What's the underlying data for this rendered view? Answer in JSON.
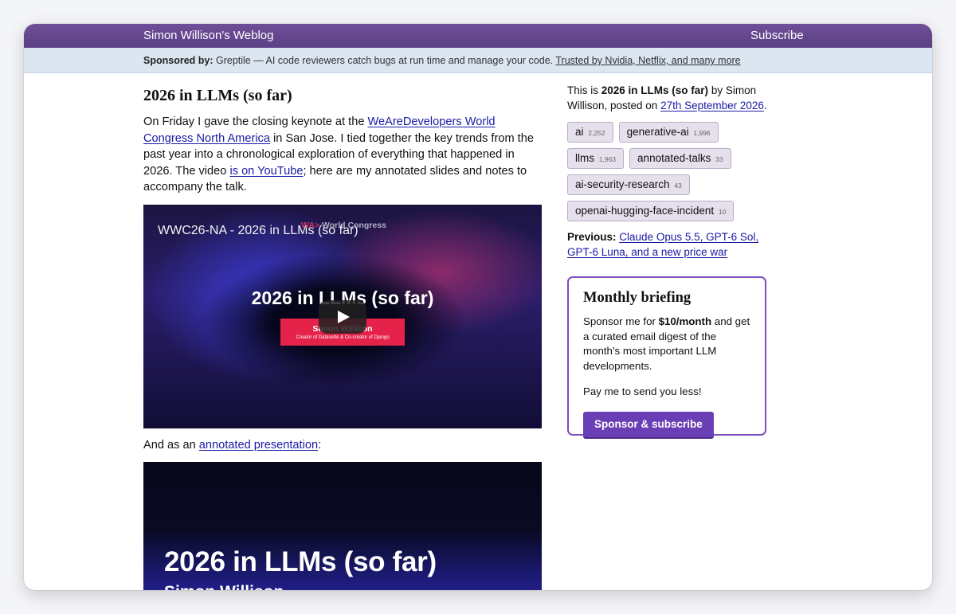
{
  "header": {
    "site_title": "Simon Willison's Weblog",
    "subscribe_label": "Subscribe"
  },
  "sponsor": {
    "label": "Sponsored by:",
    "text": " Greptile — AI code reviewers catch bugs at run time and manage your code. ",
    "link_text": "Trusted by Nvidia, Netflix, and many more"
  },
  "post": {
    "title": "2026 in LLMs (so far)",
    "intro_1": "On Friday I gave the closing keynote at the ",
    "intro_link_1": "WeAreDevelopers World Congress North America",
    "intro_2": " in San Jose. I tied together the key trends from the past year into a chronological exploration of everything that happened in 2026. The video ",
    "intro_link_2": "is on YouTube",
    "intro_3": "; here are my annotated slides and notes to accompany the talk.",
    "video": {
      "title": "WWC26-NA - 2026 in LLMs (so far)",
      "brand_mark": "WA>",
      "brand_text": "World Congress",
      "headline": "2026 in LLMs (so far)",
      "name_card": "Simon Willison",
      "name_sub": "Creator of Datasette & Co-creator of Django"
    },
    "and_as_1": "And as an ",
    "and_as_link": "annotated presentation",
    "and_as_2": ":",
    "presentation": {
      "title": "2026 in LLMs (so far)",
      "author": "Simon Willison"
    }
  },
  "sidebar": {
    "byline_1": "This is ",
    "byline_title": "2026 in LLMs (so far)",
    "byline_2": " by Simon Willison, posted on ",
    "byline_date": "27th September 2026",
    "byline_3": ".",
    "tags": [
      {
        "name": "ai",
        "count": "2,252"
      },
      {
        "name": "generative-ai",
        "count": "1,996"
      },
      {
        "name": "llms",
        "count": "1,963"
      },
      {
        "name": "annotated-talks",
        "count": "33"
      },
      {
        "name": "ai-security-research",
        "count": "43"
      },
      {
        "name": "openai-hugging-face-incident",
        "count": "10"
      }
    ],
    "previous_label": "Previous:",
    "previous_link": "Claude Opus 5.5, GPT-6 Sol, GPT-6 Luna, and a new price war",
    "briefing": {
      "title": "Monthly briefing",
      "p1_a": "Sponsor me for ",
      "p1_bold": "$10/month",
      "p1_b": " and get a curated email digest of the month's most important LLM developments.",
      "p2": "Pay me to send you less!",
      "button": "Sponsor & subscribe"
    }
  }
}
